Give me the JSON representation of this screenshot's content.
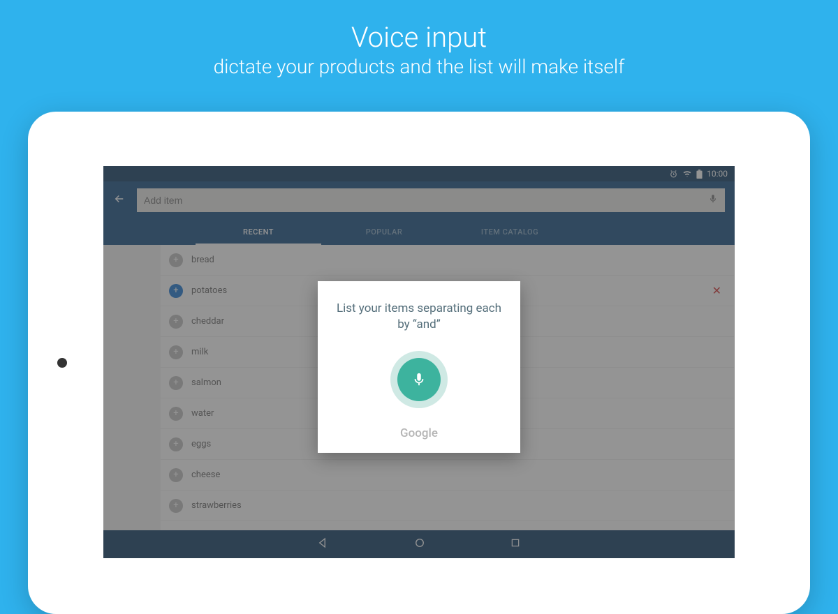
{
  "promo": {
    "title": "Voice input",
    "subtitle": "dictate your products and the list will make itself"
  },
  "status": {
    "time": "10:00"
  },
  "header": {
    "search_placeholder": "Add item"
  },
  "tabs": [
    {
      "label": "RECENT",
      "active": true
    },
    {
      "label": "POPULAR",
      "active": false
    },
    {
      "label": "ITEM CATALOG",
      "active": false
    }
  ],
  "items": [
    {
      "label": "bread",
      "selected": false
    },
    {
      "label": "potatoes",
      "selected": true,
      "deletable": true
    },
    {
      "label": "cheddar",
      "selected": false
    },
    {
      "label": "milk",
      "selected": false
    },
    {
      "label": "salmon",
      "selected": false
    },
    {
      "label": "water",
      "selected": false
    },
    {
      "label": "eggs",
      "selected": false
    },
    {
      "label": "cheese",
      "selected": false
    },
    {
      "label": "strawberries",
      "selected": false
    }
  ],
  "dialog": {
    "instruction": "List your items separating each by “and”",
    "provider": "Google"
  }
}
